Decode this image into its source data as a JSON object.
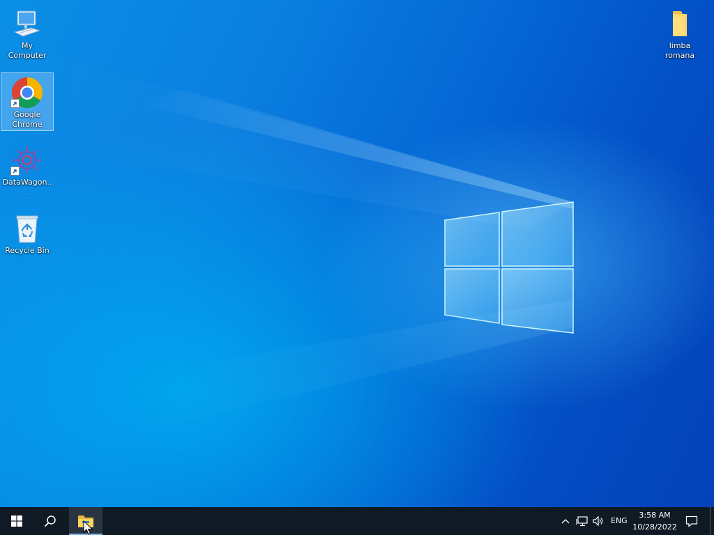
{
  "desktop": {
    "icons": [
      {
        "label": "My Computer",
        "icon": "computer-icon"
      },
      {
        "label": "Google Chrome",
        "icon": "chrome-icon",
        "selected": true,
        "shortcut": true
      },
      {
        "label": "DataWagon...",
        "icon": "datawagon-icon",
        "shortcut": true
      },
      {
        "label": "Recycle Bin",
        "icon": "recycle-bin-icon"
      },
      {
        "label": "limba romana",
        "icon": "folder-icon"
      }
    ]
  },
  "taskbar": {
    "start_icon": "windows-start-icon",
    "search_icon": "search-icon",
    "pinned": [
      {
        "icon": "file-explorer-icon",
        "active": true
      }
    ],
    "tray": {
      "overflow_icon": "chevron-up-icon",
      "network_icon": "network-icon",
      "volume_icon": "volume-icon",
      "language": "ENG",
      "time": "3:58 AM",
      "date": "10/28/2022",
      "notifications_icon": "action-center-icon"
    }
  },
  "colors": {
    "taskbar_bg": "#0f1a24",
    "accent": "#0a7fe0",
    "active_indicator": "#7bb6ef"
  }
}
